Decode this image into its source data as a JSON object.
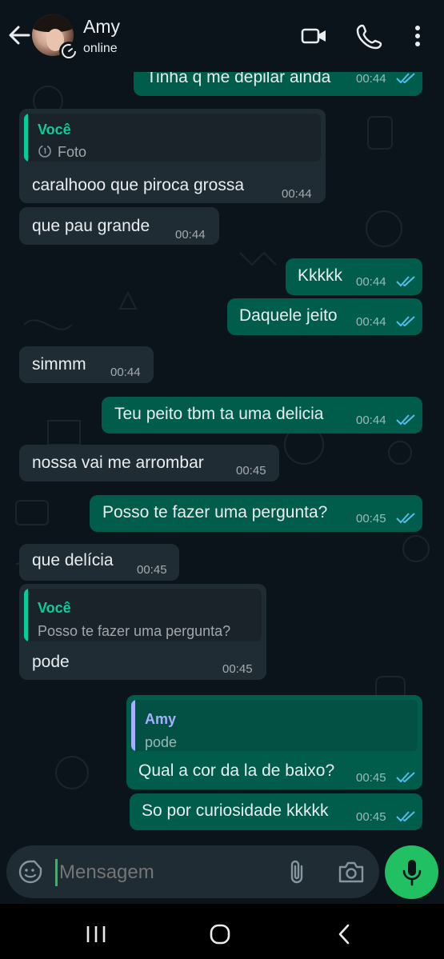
{
  "header": {
    "contact_name": "Amy",
    "status": "online"
  },
  "messages": [
    {
      "dir": "out",
      "text": "Tinha q me depilar ainda",
      "time": "00:44",
      "read": true
    },
    {
      "dir": "in",
      "quote": {
        "name": "Você",
        "text": "Foto"
      },
      "text": "caralhooo que piroca grossa",
      "time": "00:44"
    },
    {
      "dir": "in",
      "text": "que pau grande",
      "time": "00:44"
    },
    {
      "dir": "out",
      "text": "Kkkkk",
      "time": "00:44",
      "read": true
    },
    {
      "dir": "out",
      "text": "Daquele jeito",
      "time": "00:44",
      "read": true
    },
    {
      "dir": "in",
      "text": "simmm",
      "time": "00:44"
    },
    {
      "dir": "out",
      "text": "Teu peito tbm ta uma delicia",
      "time": "00:44",
      "read": true
    },
    {
      "dir": "in",
      "text": "nossa vai me arrombar",
      "time": "00:45"
    },
    {
      "dir": "out",
      "text": "Posso te fazer uma pergunta?",
      "time": "00:45",
      "read": true
    },
    {
      "dir": "in",
      "text": "que delícia",
      "time": "00:45"
    },
    {
      "dir": "in",
      "quote": {
        "name": "Você",
        "text": "Posso te fazer uma pergunta?"
      },
      "text": "pode",
      "time": "00:45"
    },
    {
      "dir": "out",
      "quote": {
        "name": "Amy",
        "text": "pode"
      },
      "text": "Qual a cor da la de baixo?",
      "time": "00:45",
      "read": true
    },
    {
      "dir": "out",
      "text": "So por curiosidade kkkkk",
      "time": "00:45",
      "read": true
    }
  ],
  "composer": {
    "placeholder": "Mensagem"
  },
  "colors": {
    "incoming": "#202c33",
    "outgoing": "#005c4b",
    "accent": "#21c063",
    "read_ticks": "#53bdeb",
    "quote_you": "#06cf9c",
    "quote_amy": "#a5b1ff"
  },
  "icons": [
    "back-arrow-icon",
    "disappearing-timer-icon",
    "video-call-icon",
    "voice-call-icon",
    "more-options-icon",
    "sticker-icon",
    "attach-icon",
    "camera-icon",
    "mic-icon",
    "nav-recents-icon",
    "nav-home-icon",
    "nav-back-icon",
    "view-once-icon"
  ]
}
